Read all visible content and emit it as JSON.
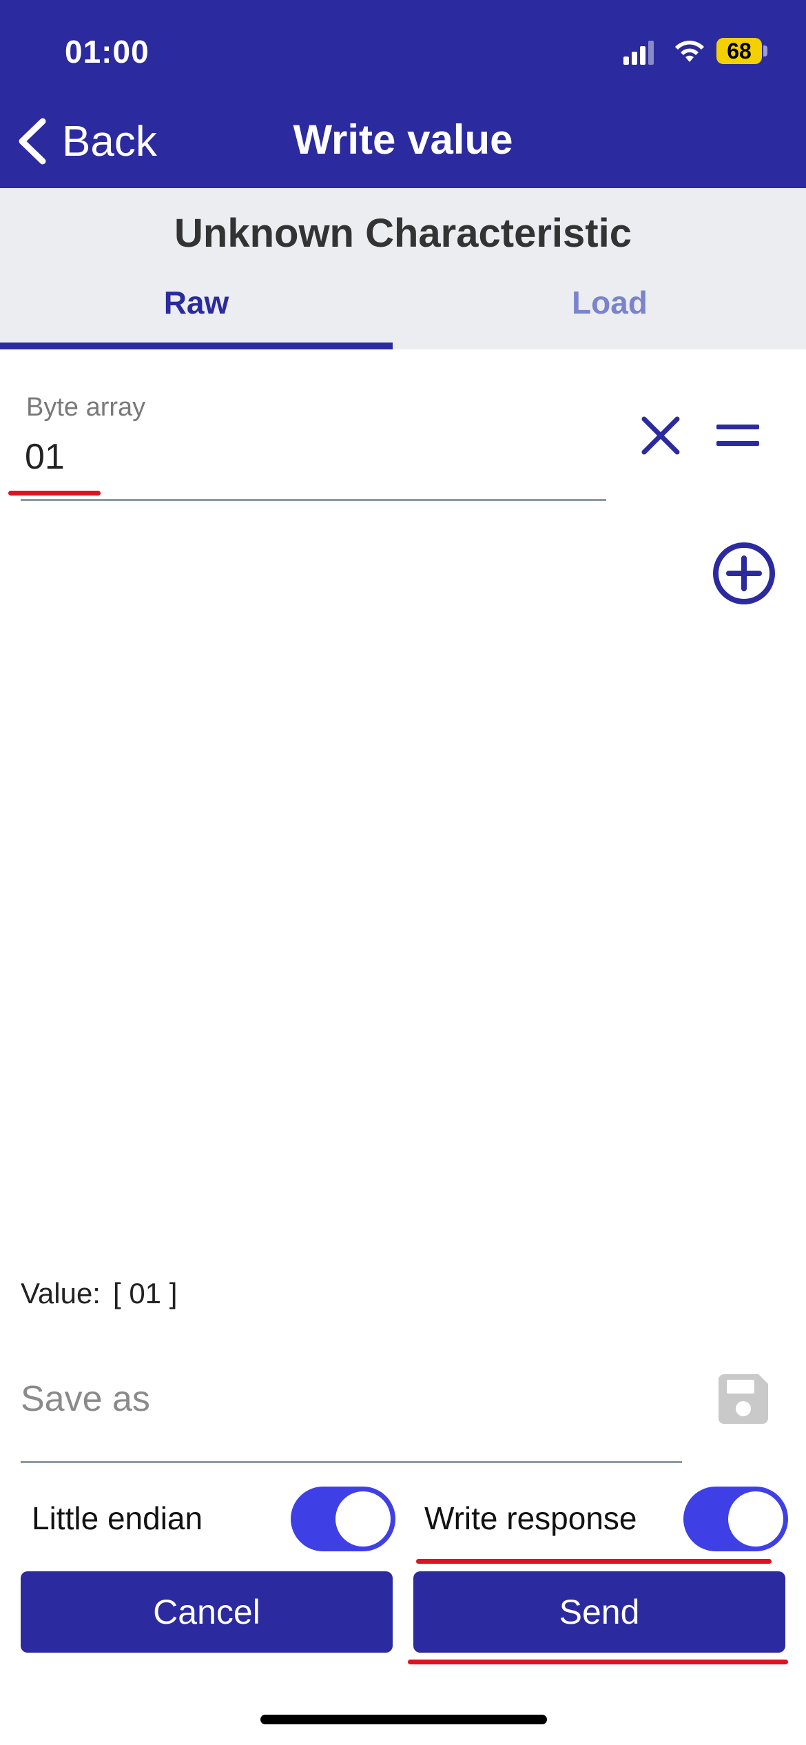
{
  "status_bar": {
    "time": "01:00",
    "battery": "68"
  },
  "nav": {
    "back_label": "Back",
    "title": "Write value"
  },
  "header": {
    "subtitle": "Unknown Characteristic",
    "tabs": [
      {
        "label": "Raw",
        "active": true
      },
      {
        "label": "Load",
        "active": false
      }
    ]
  },
  "byte_array": {
    "label": "Byte array",
    "value": "01"
  },
  "value_display": {
    "label": "Value:",
    "value": "[ 01 ]"
  },
  "save_as": {
    "placeholder": "Save as",
    "value": ""
  },
  "toggles": {
    "little_endian": {
      "label": "Little endian",
      "on": true
    },
    "write_response": {
      "label": "Write response",
      "on": true
    }
  },
  "buttons": {
    "cancel": "Cancel",
    "send": "Send"
  },
  "colors": {
    "primary": "#2b2a9e",
    "toggle_on": "#3f3fe6",
    "header_band": "#ebedf0",
    "annotation_red": "#e0121f"
  },
  "icons": [
    "chevron-left-icon",
    "clear-icon",
    "equals-icon",
    "add-circle-icon",
    "save-icon",
    "signal-icon",
    "wifi-icon",
    "battery-icon"
  ]
}
